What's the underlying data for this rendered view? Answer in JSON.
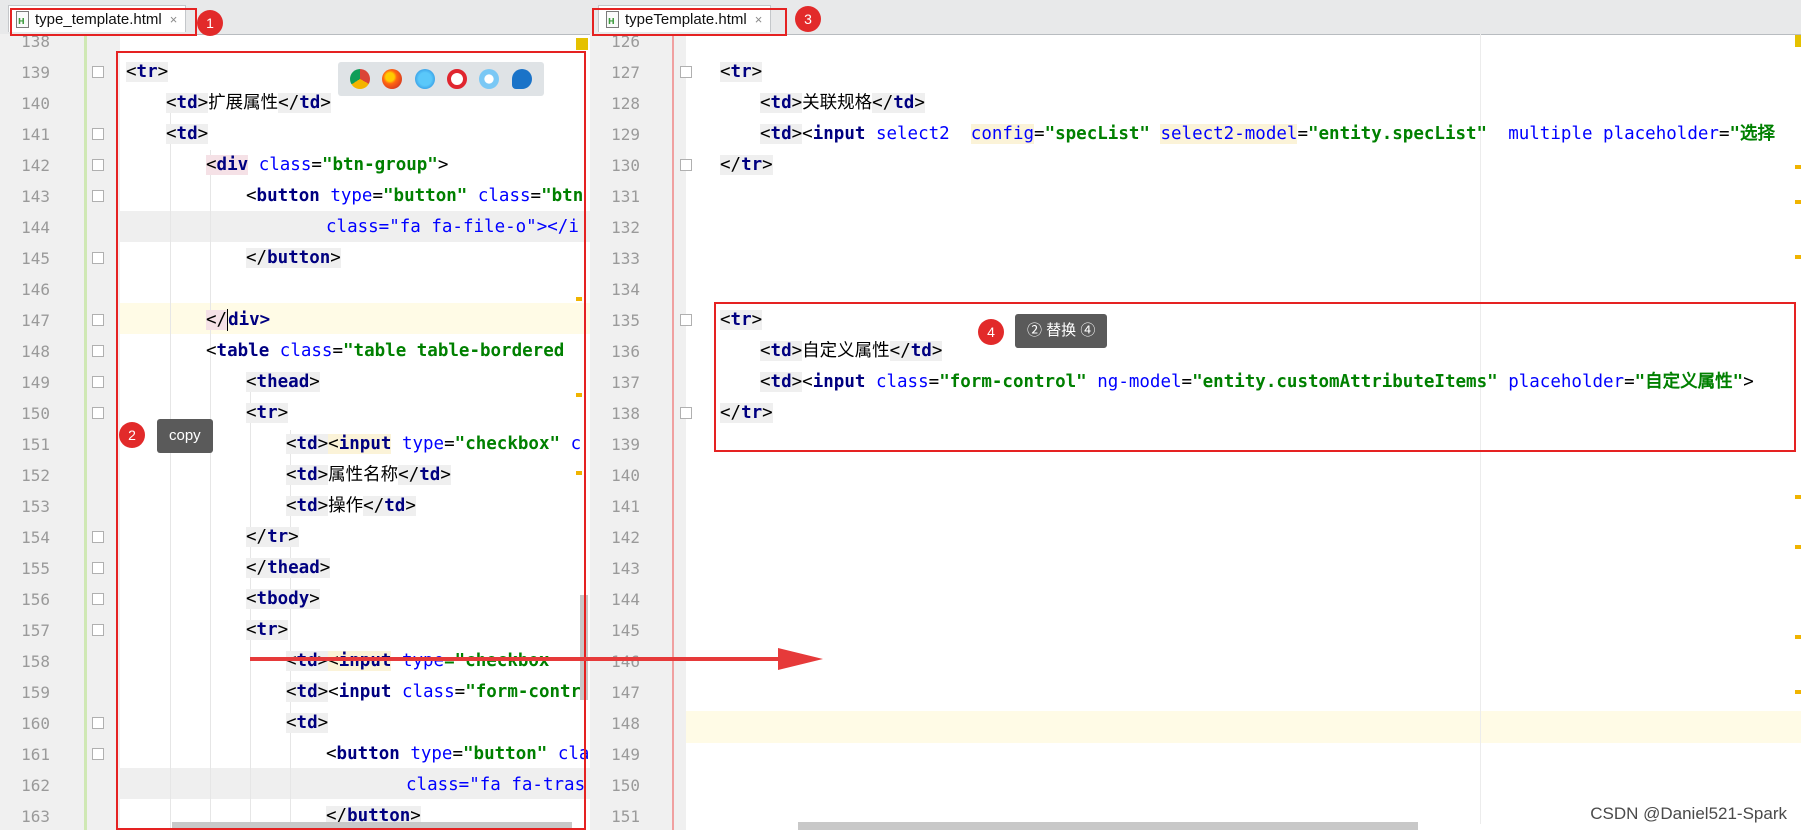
{
  "left_tab": {
    "title": "type_template.html",
    "close": "×"
  },
  "right_tab": {
    "title": "typeTemplate.html",
    "close": "×"
  },
  "badges": {
    "b1": "1",
    "b2": "2",
    "b3": "3",
    "b4": "4"
  },
  "tooltips": {
    "copy": "copy",
    "replace": "② 替换 ④"
  },
  "browser_icons": [
    "chrome-icon",
    "firefox-icon",
    "safari-icon",
    "opera-icon",
    "ie-icon",
    "edge-icon"
  ],
  "colors": {
    "annotation_red": "#e52222",
    "tag": "#000080",
    "attr": "#0000ff",
    "value": "#008000"
  },
  "left_editor": {
    "line_numbers": [
      "138",
      "139",
      "140",
      "141",
      "142",
      "143",
      "144",
      "145",
      "146",
      "147",
      "148",
      "149",
      "150",
      "151",
      "152",
      "153",
      "154",
      "155",
      "156",
      "157",
      "158",
      "159",
      "160",
      "161",
      "162",
      "163"
    ],
    "l139": {
      "tag": "tr"
    },
    "l140": {
      "tag": "td",
      "text": "扩展属性"
    },
    "l141": {
      "tag": "td"
    },
    "l142": {
      "tag": "div",
      "attr": "class",
      "val": "\"btn-group\""
    },
    "l143": {
      "tag": "button",
      "attr1": "type",
      "val1": "\"button\"",
      "attr2": "class",
      "val2": "\"btn"
    },
    "l144": {
      "text": "class=\"fa fa-file-o\"></i"
    },
    "l145": {
      "tag": "button"
    },
    "l147": {
      "pre": "</",
      "post": "div>"
    },
    "l148": {
      "tag": "table",
      "attr": "class",
      "val": "\"table table-bordered"
    },
    "l149": {
      "tag": "thead"
    },
    "l150": {
      "tag": "tr"
    },
    "l151": {
      "tag": "td",
      "tag2": "input",
      "attr": "type",
      "val": "\"checkbox\"",
      "rest": "c"
    },
    "l152": {
      "tag": "td",
      "text": "属性名称"
    },
    "l153": {
      "tag": "td",
      "text": "操作"
    },
    "l154": {
      "tag": "tr"
    },
    "l155": {
      "tag": "thead"
    },
    "l156": {
      "tag": "tbody"
    },
    "l157": {
      "tag": "tr"
    },
    "l158": {
      "tag": "td",
      "tag2": "input",
      "attr": "type",
      "val": "=\"checkbox"
    },
    "l159": {
      "tag": "td",
      "tag2": "input",
      "attr": "class",
      "val": "\"form-contr"
    },
    "l160": {
      "tag": "td"
    },
    "l161": {
      "tag": "button",
      "attr": "type",
      "val": "\"button\"",
      "rest": "cla"
    },
    "l162": {
      "text": "class=\"fa fa-tras"
    },
    "l163": {
      "tag": "button"
    }
  },
  "right_editor": {
    "line_numbers": [
      "126",
      "127",
      "128",
      "129",
      "130",
      "131",
      "132",
      "133",
      "134",
      "135",
      "136",
      "137",
      "138",
      "139",
      "140",
      "141",
      "142",
      "143",
      "144",
      "145",
      "146",
      "147",
      "148",
      "149",
      "150",
      "151"
    ],
    "r127": {
      "tag": "tr"
    },
    "r128": {
      "tag": "td",
      "text": "关联规格"
    },
    "r129": {
      "tag": "td",
      "tag2": "input",
      "attr1": "select2",
      "attr2": "config",
      "val2": "\"specList\"",
      "attr3": "select2-model",
      "val3": "\"entity.specList\"",
      "attr4": "multiple",
      "attr5": "placeholder",
      "val5": "\"选择"
    },
    "r130": {
      "tag": "tr"
    },
    "r135": {
      "tag": "tr"
    },
    "r136": {
      "tag": "td",
      "text": "自定义属性"
    },
    "r137": {
      "tag": "td",
      "tag2": "input",
      "attr1": "class",
      "val1": "\"form-control\"",
      "attr2": "ng-model",
      "val2": "\"entity.customAttributeItems\"",
      "attr3": "placeholder",
      "val3": "\"自定义属性\""
    },
    "r138": {
      "tag": "tr"
    }
  },
  "watermark": "CSDN @Daniel521-Spark"
}
